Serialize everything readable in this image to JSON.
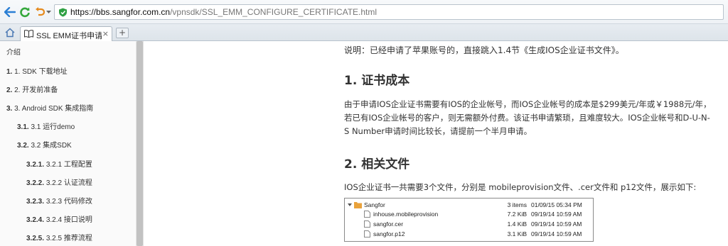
{
  "browser": {
    "url_host": "https://bbs.sangfor.com.cn",
    "url_path": "/vpnsdk/SSL_EMM_CONFIGURE_CERTIFICATE.html",
    "tab_title": "SSL EMM证书申请及配置",
    "tab_close": "×",
    "new_tab": "+"
  },
  "sidebar": {
    "items": [
      {
        "num": "",
        "label": "介绍"
      },
      {
        "num": "1.",
        "label": "1. SDK 下载地址"
      },
      {
        "num": "2.",
        "label": "2. 开发前准备"
      },
      {
        "num": "3.",
        "label": "3. Android SDK 集成指南"
      },
      {
        "num": "3.1.",
        "label": "3.1 运行demo"
      },
      {
        "num": "3.2.",
        "label": "3.2 集成SDK"
      },
      {
        "num": "3.2.1.",
        "label": "3.2.1 工程配置"
      },
      {
        "num": "3.2.2.",
        "label": "3.2.2 认证流程"
      },
      {
        "num": "3.2.3.",
        "label": "3.2.3 代码修改"
      },
      {
        "num": "3.2.4.",
        "label": "3.2.4 接口说明"
      },
      {
        "num": "3.2.5.",
        "label": "3.2.5 推荐流程"
      }
    ]
  },
  "content": {
    "note": "说明：已经申请了苹果账号的，直接跳入1.4节《生成IOS企业证书文件》。",
    "h1": "1. 证书成本",
    "p1": "由于申请IOS企业证书需要有IOS的企业帐号，而IOS企业帐号的成本是$299美元/年或￥1988元/年，若已有IOS企业帐号的客户，则无需额外付费。该证书申请繁琐，且难度较大。IOS企业帐号和D-U-N-S Number申请时间比较长，请提前一个半月申请。",
    "h2": "2. 相关文件",
    "p2": "IOS企业证书一共需要3个文件，分别是 mobileprovision文件、.cer文件和 p12文件，展示如下:",
    "files": [
      {
        "name": "Sangfor",
        "size": "3 items",
        "date": "01/09/15 05:34 PM",
        "type": "folder"
      },
      {
        "name": "inhouse.mobileprovision",
        "size": "7.2 KiB",
        "date": "09/19/14 10:59 AM",
        "type": "file"
      },
      {
        "name": "sangfor.cer",
        "size": "1.4 KiB",
        "date": "09/19/14 10:59 AM",
        "type": "file"
      },
      {
        "name": "sangfor.p12",
        "size": "3.1 KiB",
        "date": "09/19/14 10:59 AM",
        "type": "file"
      }
    ]
  }
}
